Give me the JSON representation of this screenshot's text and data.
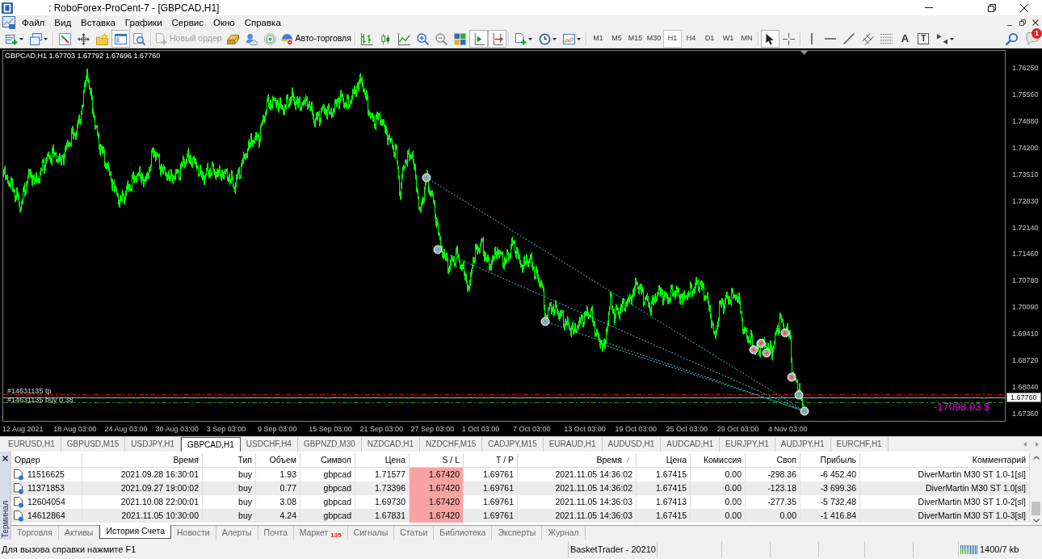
{
  "window": {
    "title": ": RoboForex-ProCent-7 - [GBPCAD,H1]"
  },
  "menu": [
    "Файл",
    "Вид",
    "Вставка",
    "Графики",
    "Сервис",
    "Окно",
    "Справка"
  ],
  "toolbar": {
    "new_order": {
      "label": "Новый ордер",
      "disabled": true
    },
    "auto_trading": {
      "label": "Авто-торговля"
    },
    "pressed": {
      "terminal": true,
      "chart_shift": true,
      "auto_scroll": true,
      "cursor": true
    },
    "timeframes": [
      {
        "label": "M1",
        "selected": false
      },
      {
        "label": "M5",
        "selected": false
      },
      {
        "label": "M15",
        "selected": false
      },
      {
        "label": "M30",
        "selected": false
      },
      {
        "label": "H1",
        "selected": true
      },
      {
        "label": "H4",
        "selected": false
      },
      {
        "label": "D1",
        "selected": false
      },
      {
        "label": "W1",
        "selected": false
      },
      {
        "label": "MN",
        "selected": false
      }
    ],
    "text_tool": "A",
    "label_tool": "T",
    "notifications": "1"
  },
  "chart": {
    "header": "GBPCAD,H1 1.67703 1.67792 1.67696 1.67760",
    "order_labels": [
      "#14631135 tp",
      "#14631135 buy 0.38"
    ],
    "profit": "-17098.03 $",
    "price_scale": [
      {
        "label": "1.76250",
        "kind": "tick"
      },
      {
        "label": "1.75560",
        "kind": "tick"
      },
      {
        "label": "1.74880",
        "kind": "tick"
      },
      {
        "label": "1.74200",
        "kind": "tick"
      },
      {
        "label": "1.73510",
        "kind": "tick"
      },
      {
        "label": "1.72830",
        "kind": "tick"
      },
      {
        "label": "1.72140",
        "kind": "tick"
      },
      {
        "label": "1.71460",
        "kind": "tick"
      },
      {
        "label": "1.70780",
        "kind": "tick"
      },
      {
        "label": "1.70090",
        "kind": "tick"
      },
      {
        "label": "1.69410",
        "kind": "tick"
      },
      {
        "label": "1.68720",
        "kind": "tick"
      },
      {
        "label": "1.68040",
        "kind": "tick"
      },
      {
        "label": "1.67760",
        "kind": "current"
      },
      {
        "label": "1.67360",
        "kind": "tick"
      }
    ],
    "time_scale": [
      "12 Aug 2021",
      "18 Aug 03:00",
      "24 Aug 03:00",
      "30 Aug 03:00",
      "3 Sep 03:00",
      "9 Sep 03:00",
      "15 Sep 03:00",
      "21 Sep 03:00",
      "27 Sep 03:00",
      "1 Oct 03:00",
      "7 Oct 03:00",
      "13 Oct 03:00",
      "19 Oct 03:00",
      "25 Oct 03:00",
      "29 Oct 03:00",
      "4 Nov 03:00"
    ]
  },
  "chart_tabs": [
    {
      "label": "EURUSD,H1",
      "selected": false
    },
    {
      "label": "GBPUSD,M15",
      "selected": false
    },
    {
      "label": "USDJPY,H1",
      "selected": false
    },
    {
      "label": "GBPCAD,H1",
      "selected": true
    },
    {
      "label": "USDCHF,H4",
      "selected": false
    },
    {
      "label": "GBPNZD,M30",
      "selected": false
    },
    {
      "label": "NZDCAD,H1",
      "selected": false
    },
    {
      "label": "NZDCHF,M15",
      "selected": false
    },
    {
      "label": "CADJPY,M15",
      "selected": false
    },
    {
      "label": "EURAUD,H1",
      "selected": false
    },
    {
      "label": "AUDUSD,H1",
      "selected": false
    },
    {
      "label": "AUDCAD,H1",
      "selected": false
    },
    {
      "label": "EURJPY,H1",
      "selected": false
    },
    {
      "label": "AUDJPY,H1",
      "selected": false
    },
    {
      "label": "EURCHF,H1",
      "selected": false
    }
  ],
  "terminal": {
    "title": "Терминал",
    "columns": [
      {
        "label": "Ордер",
        "sorted": false
      },
      {
        "label": "Время",
        "sorted": false
      },
      {
        "label": "Тип",
        "sorted": false
      },
      {
        "label": "Объем",
        "sorted": false
      },
      {
        "label": "Символ",
        "sorted": false
      },
      {
        "label": "Цена",
        "sorted": false
      },
      {
        "label": "S / L",
        "sorted": false
      },
      {
        "label": "T / P",
        "sorted": false
      },
      {
        "label": "Время",
        "sorted": true
      },
      {
        "label": "Цена",
        "sorted": false
      },
      {
        "label": "Комиссия",
        "sorted": false
      },
      {
        "label": "Своп",
        "sorted": false
      },
      {
        "label": "Прибыль",
        "sorted": false
      },
      {
        "label": "Комментарий",
        "sorted": false
      }
    ],
    "rows": [
      {
        "cells": [
          "11516625",
          "2021.09.28 16:30:01",
          "buy",
          "1.93",
          "gbpcad",
          "1.71577",
          "1.67420",
          "1.69761",
          "2021.11.05 14:36:02",
          "1.67415",
          "0.00",
          "-298.36",
          "-6 452.40",
          "DiverMartin M30 ST 1.0-1[sl]"
        ],
        "sl_hit": true
      },
      {
        "cells": [
          "11371853",
          "2021.09.27 19:00:02",
          "buy",
          "0.77",
          "gbpcad",
          "1.73396",
          "1.67420",
          "1.69761",
          "2021.11.05 14:36:02",
          "1.67415",
          "0.00",
          "-123.18",
          "-3 699.36",
          "DiverMartin M30 ST 1.0[sl]"
        ],
        "sl_hit": true
      },
      {
        "cells": [
          "12604054",
          "2021.10.08 22:00:01",
          "buy",
          "3.08",
          "gbpcad",
          "1.69730",
          "1.67420",
          "1.69761",
          "2021.11.05 14:36:03",
          "1.67413",
          "0.00",
          "-277.35",
          "-5 732.48",
          "DiverMartin M30 ST 1.0-2[sl]"
        ],
        "sl_hit": true
      },
      {
        "cells": [
          "14612864",
          "2021.11.05 10:30:00",
          "buy",
          "4.24",
          "gbpcad",
          "1.67831",
          "1.67420",
          "1.69761",
          "2021.11.05 14:36:03",
          "1.67415",
          "0.00",
          "0.00",
          "-1 416.84",
          "DiverMartin M30 ST 1.0-3[sl]"
        ],
        "sl_hit": true
      }
    ],
    "tabs": [
      {
        "label": "Торговля",
        "selected": false
      },
      {
        "label": "Активы",
        "selected": false
      },
      {
        "label": "История Счета",
        "selected": true
      },
      {
        "label": "Новости",
        "selected": false
      },
      {
        "label": "Алерты",
        "selected": false
      },
      {
        "label": "Почта",
        "selected": false
      },
      {
        "label": "Маркет",
        "badge": "135",
        "selected": false
      },
      {
        "label": "Сигналы",
        "selected": false
      },
      {
        "label": "Статьи",
        "selected": false
      },
      {
        "label": "Библиотека",
        "selected": false
      },
      {
        "label": "Эксперты",
        "selected": false
      },
      {
        "label": "Журнал",
        "selected": false
      }
    ]
  },
  "status_bar": {
    "help": "Для вызова справки нажмите F1",
    "profile": "BasketTrader - 20210",
    "traffic": "1400/7 kb"
  }
}
